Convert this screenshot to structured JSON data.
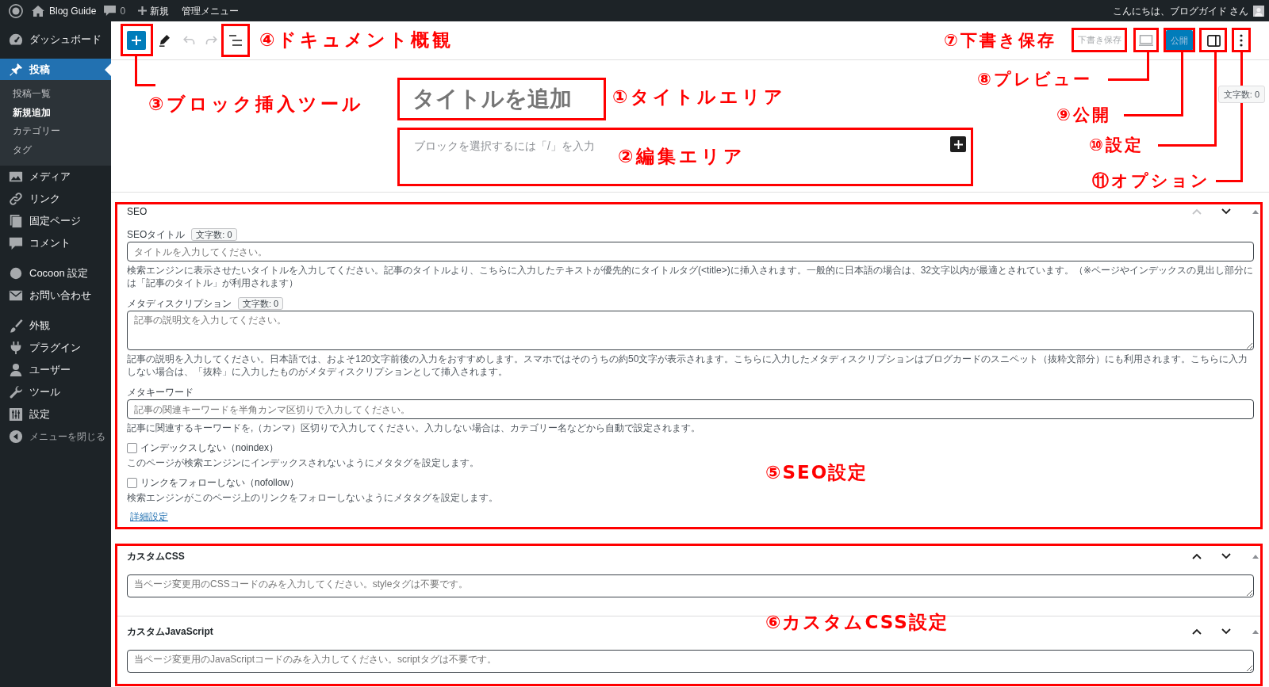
{
  "admin_bar": {
    "site_name": "Blog Guide",
    "comments": "0",
    "new_label": "新規",
    "menu_label": "管理メニュー",
    "greeting": "こんにちは、ブログガイド さん"
  },
  "sidebar": {
    "sections": [
      {
        "items": [
          {
            "label": "ダッシュボード",
            "selected": false
          }
        ]
      },
      {
        "items": [
          {
            "label": "投稿",
            "selected": true,
            "children": [
              {
                "label": "投稿一覧",
                "selected": false
              },
              {
                "label": "新規追加",
                "selected": true
              },
              {
                "label": "カテゴリー",
                "selected": false
              },
              {
                "label": "タグ",
                "selected": false
              }
            ]
          },
          {
            "label": "メディア",
            "selected": false
          },
          {
            "label": "リンク",
            "selected": false
          },
          {
            "label": "固定ページ",
            "selected": false
          },
          {
            "label": "コメント",
            "selected": false
          }
        ]
      },
      {
        "items": [
          {
            "label": "Cocoon 設定",
            "selected": false
          },
          {
            "label": "お問い合わせ",
            "selected": false
          }
        ]
      },
      {
        "items": [
          {
            "label": "外観",
            "selected": false
          },
          {
            "label": "プラグイン",
            "selected": false
          },
          {
            "label": "ユーザー",
            "selected": false
          },
          {
            "label": "ツール",
            "selected": false
          },
          {
            "label": "設定",
            "selected": false
          }
        ]
      }
    ],
    "collapse_label": "メニューを閉じる"
  },
  "toolbar": {
    "undo": {
      "disabled": true
    },
    "redo": {
      "disabled": true
    },
    "save_draft": {
      "label": "下書き保存",
      "disabled": true
    },
    "publish": {
      "label": "公開",
      "disabled": true
    }
  },
  "editor": {
    "title_placeholder": "タイトルを追加",
    "block_placeholder": "ブロックを選択するには「/」を入力",
    "word_count": "文字数: 0"
  },
  "seo_box": {
    "title": "SEO",
    "up_disabled": true,
    "fields": [
      {
        "kind": "input",
        "label": "SEOタイトル",
        "count": "文字数: 0",
        "placeholder": "タイトルを入力してください。",
        "help": "検索エンジンに表示させたいタイトルを入力してください。記事のタイトルより、こちらに入力したテキストが優先的にタイトルタグ(<title>)に挿入されます。一般的に日本語の場合は、32文字以内が最適とされています。（※ページやインデックスの見出し部分には「記事のタイトル」が利用されます）"
      },
      {
        "kind": "textarea",
        "label": "メタディスクリプション",
        "count": "文字数: 0",
        "placeholder": "記事の説明文を入力してください。",
        "help": "記事の説明を入力してください。日本語では、およそ120文字前後の入力をおすすめします。スマホではそのうちの約50文字が表示されます。こちらに入力したメタディスクリプションはブログカードのスニペット（抜粋文部分）にも利用されます。こちらに入力しない場合は、「抜粋」に入力したものがメタディスクリプションとして挿入されます。"
      },
      {
        "kind": "input",
        "label": "メタキーワード",
        "placeholder": "記事の関連キーワードを半角カンマ区切りで入力してください。",
        "help": "記事に関連するキーワードを,（カンマ）区切りで入力してください。入力しない場合は、カテゴリー名などから自動で設定されます。"
      },
      {
        "kind": "checkbox",
        "label": "インデックスしない（noindex）",
        "checked": false,
        "help": "このページが検索エンジンにインデックスされないようにメタタグを設定します。"
      },
      {
        "kind": "checkbox",
        "label": "リンクをフォローしない（nofollow）",
        "checked": false,
        "help": "検索エンジンがこのページ上のリンクをフォローしないようにメタタグを設定します。"
      },
      {
        "kind": "link",
        "label": "詳細設定"
      }
    ]
  },
  "custom_boxes": [
    {
      "title": "カスタムCSS",
      "up_disabled": false,
      "placeholder": "当ページ変更用のCSSコードのみを入力してください。styleタグは不要です。"
    },
    {
      "title": "カスタムJavaScript",
      "up_disabled": false,
      "placeholder": "当ページ変更用のJavaScriptコードのみを入力してください。scriptタグは不要です。"
    }
  ],
  "annotations": [
    {
      "label": "①タイトルエリア"
    },
    {
      "label": "②編集エリア"
    },
    {
      "label": "③ブロック挿入ツール"
    },
    {
      "label": "④ドキュメント概観"
    },
    {
      "label": "⑤SEO設定"
    },
    {
      "label": "⑥カスタムCSS設定"
    },
    {
      "label": "⑦下書き保存"
    },
    {
      "label": "⑧プレビュー"
    },
    {
      "label": "⑨公開"
    },
    {
      "label": "⑩設定"
    },
    {
      "label": "⑪オプション"
    }
  ]
}
